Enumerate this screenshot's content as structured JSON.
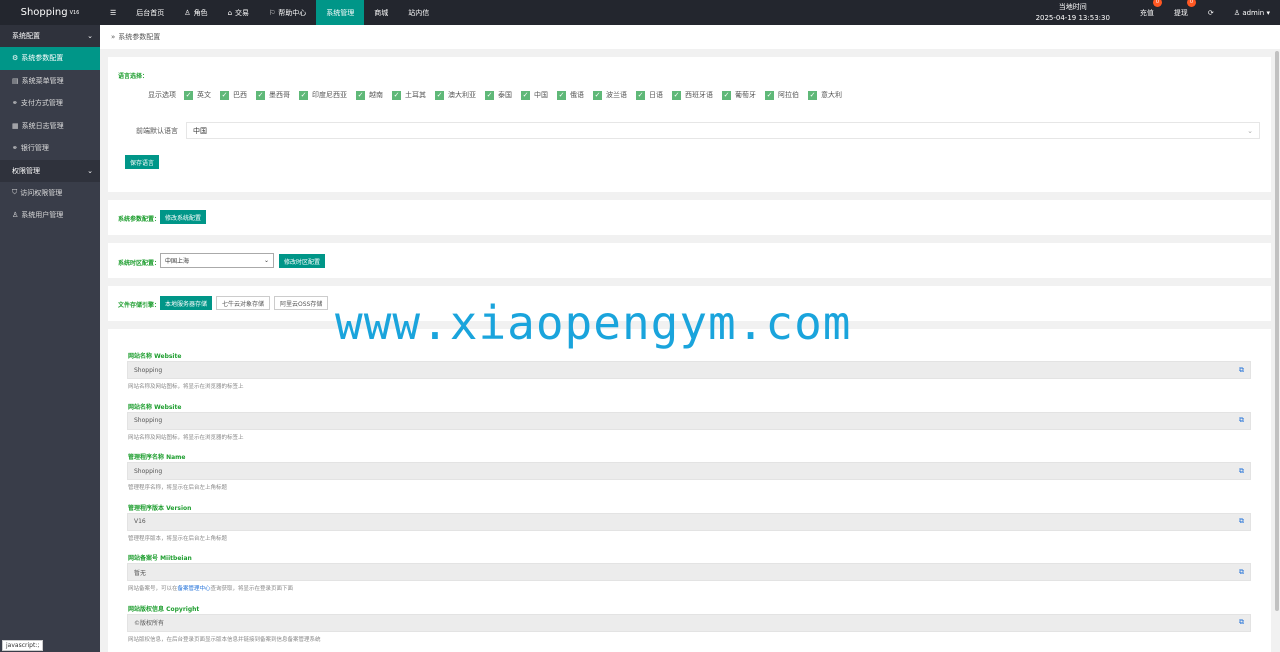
{
  "app": {
    "logo": "Shopping",
    "version": "V16"
  },
  "nav": {
    "menu_icon": "☰",
    "items": [
      {
        "label": "后台首页",
        "icon": ""
      },
      {
        "label": "角色",
        "icon": "user-icon"
      },
      {
        "label": "交易",
        "icon": "bank-icon"
      },
      {
        "label": "帮助中心",
        "icon": "flag-icon"
      },
      {
        "label": "系统管理",
        "icon": "",
        "active": true
      },
      {
        "label": "商城",
        "icon": ""
      },
      {
        "label": "站内信",
        "icon": ""
      }
    ]
  },
  "topright": {
    "time_label": "当地时间",
    "time_value": "2025-04-19 13:53:30",
    "recharge": "充值",
    "recharge_badge": "0",
    "withdraw": "提现",
    "withdraw_badge": "0",
    "refresh_icon": "refresh-icon",
    "user": "admin"
  },
  "sidebar": {
    "group1": "系统配置",
    "items1": [
      "系统参数配置",
      "系统菜单管理",
      "支付方式管理",
      "系统日志管理",
      "银行管理"
    ],
    "group2": "权限管理",
    "items2": [
      "访问权限管理",
      "系统用户管理"
    ],
    "status": "javascript:;"
  },
  "breadcrumb": {
    "sep": "»",
    "label": "系统参数配置"
  },
  "language": {
    "title": "语言选择：",
    "show_label": "显示选项",
    "options": [
      "英文",
      "巴西",
      "墨西哥",
      "印度尼西亚",
      "越南",
      "土耳其",
      "澳大利亚",
      "泰国",
      "中国",
      "俄语",
      "波兰语",
      "日语",
      "西班牙语",
      "葡萄牙",
      "阿拉伯",
      "意大利"
    ],
    "default_label": "前端默认语言",
    "default_value": "中国",
    "save_button": "保存语言"
  },
  "sysparam": {
    "label": "系统参数配置：",
    "button": "修改系统配置"
  },
  "timezone": {
    "label": "系统时区配置：",
    "value": "中国上海",
    "button": "修改时区配置"
  },
  "storage": {
    "label": "文件存储引擎：",
    "options": [
      "本地服务器存储",
      "七牛云对象存储",
      "阿里云OSS存储"
    ]
  },
  "fields": [
    {
      "label": "网站名称 Website",
      "value": "Shopping",
      "help": "网站名称及网站图标，将显示在浏览器的标签上"
    },
    {
      "label": "网站名称 Website",
      "value": "Shopping",
      "help": "网站名称及网站图标，将显示在浏览器的标签上"
    },
    {
      "label": "管理程序名称 Name",
      "value": "Shopping",
      "help": "管理程序名称，将显示在后台左上角标题"
    },
    {
      "label": "管理程序版本 Version",
      "value": "V16",
      "help": "管理程序版本，将显示在后台左上角标题"
    },
    {
      "label": "网站备案号 Miitbeian",
      "value": "暂无",
      "help_pre": "网站备案号，可以在",
      "help_link": "备案管理中心",
      "help_post": "查询获取，将显示在登录页面下面"
    },
    {
      "label": "网站版权信息 Copyright",
      "value": "©版权所有",
      "help": "网站版权信息，在后台登录页面显示版本信息并链接到备案到信息备案管理系统"
    }
  ],
  "watermark": "www.xiaopengym.com"
}
